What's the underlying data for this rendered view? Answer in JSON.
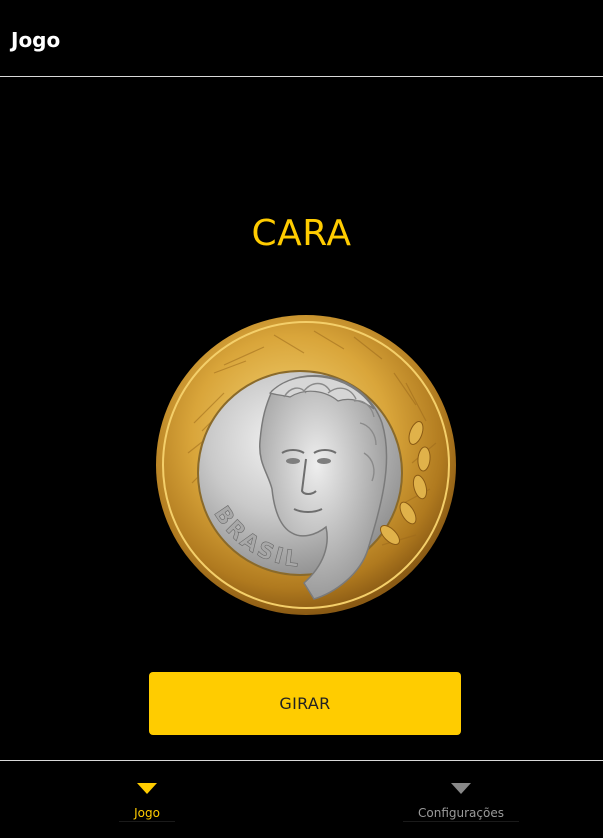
{
  "app_bar": {
    "title": "Jogo"
  },
  "game": {
    "result": "CARA",
    "coin_image": "brazil-1-real-coin-heads-icon",
    "coin_inscription": "BRASIL",
    "spin_button_label": "GIRAR"
  },
  "bottom_nav": {
    "items": [
      {
        "label": "Jogo",
        "icon": "triangle-down-icon",
        "active": true
      },
      {
        "label": "Configurações",
        "icon": "triangle-down-icon",
        "active": false
      }
    ]
  },
  "colors": {
    "accent": "#ffcc00",
    "background": "#000000",
    "divider": "#d9d9d9",
    "inactive": "#888888"
  }
}
